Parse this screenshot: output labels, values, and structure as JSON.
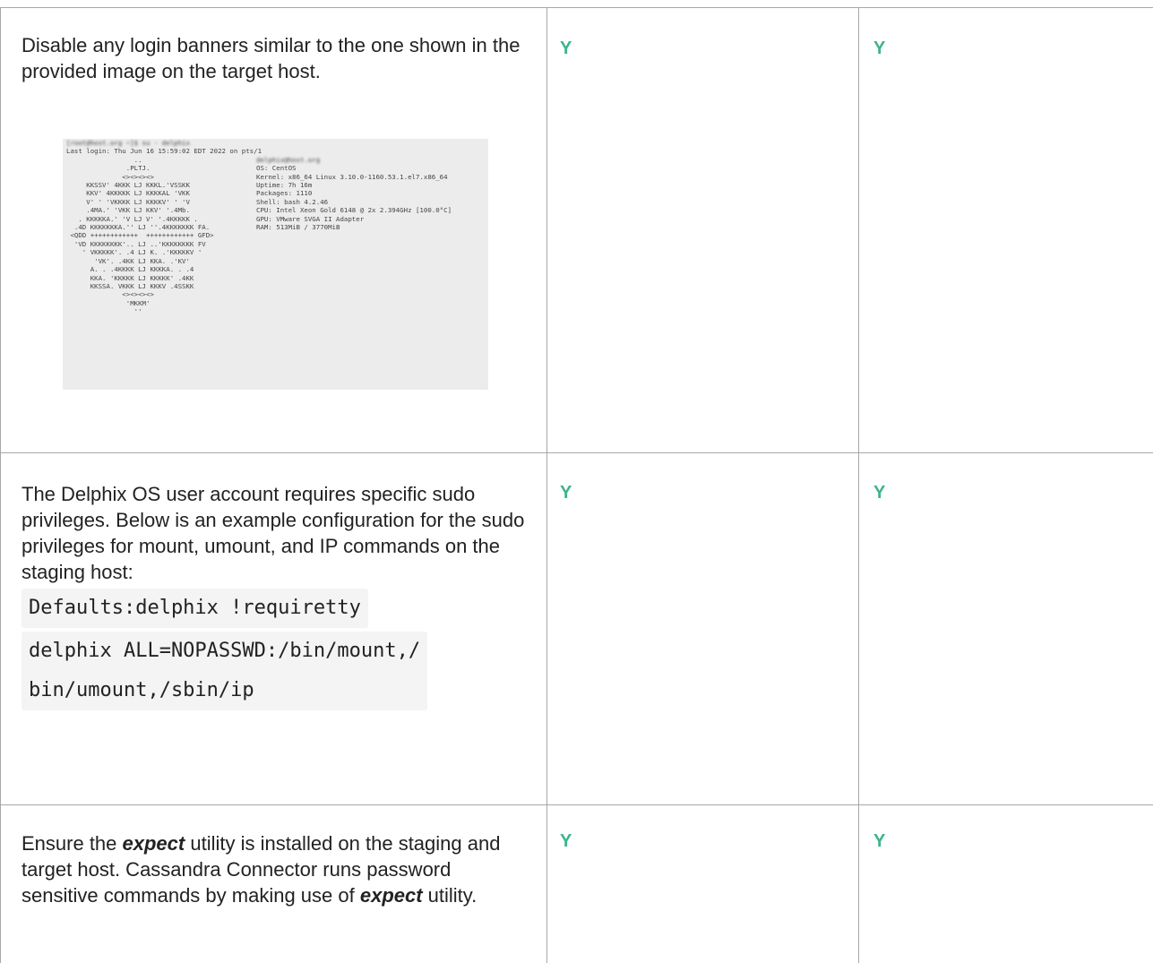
{
  "rows": [
    {
      "requirement": "Disable any login banners similar to the one shown in the provided image on the target host.",
      "col2": "Y",
      "col3": "Y",
      "banner": {
        "blurred_header": "[root@host.org ~]$ su - delphix",
        "last_login": "Last login: Thu Jun 16 15:59:02 EDT 2022 on pts/1",
        "blurred_user": "delphix@host.org",
        "art_lines": [
          "                 ..",
          "               .PLTJ.",
          "              <><><><>",
          "     KKSSV' 4KKK LJ KKKL.'VSSKK",
          "     KKV' 4KKKKK LJ KKKKAL 'VKK",
          "     V' ' 'VKKKK LJ KKKKV' ' 'V",
          "     .4MA.' 'VKK LJ KKV' '.4Mb.",
          "   . KKKKKA.' 'V LJ V' '.4KKKKK .",
          "  .4D KKKKKKKA.'' LJ ''.4KKKKKKK FA.",
          " <QDD ++++++++++++  ++++++++++++ GFD>",
          "  'VD KKKKKKKK'.. LJ ..'KKKKKKKK FV",
          "    ' VKKKKK'. .4 LJ K. .'KKKKKV '",
          "       'VK'. .4KK LJ KKA. .'KV'",
          "      A. . .4KKKK LJ KKKKA. . .4",
          "      KKA. 'KKKKK LJ KKKKK' .4KK",
          "      KKSSA. VKKK LJ KKKV .4SSKK",
          "              <><><><>",
          "               'MKKM'",
          "                 ''"
        ],
        "info_lines": [
          "OS: CentOS",
          "Kernel: x86_64 Linux 3.10.0-1160.53.1.el7.x86_64",
          "Uptime: 7h 16m",
          "Packages: 1110",
          "Shell: bash 4.2.46",
          "CPU: Intel Xeon Gold 6148 @ 2x 2.394GHz [100.0°C]",
          "GPU: VMware SVGA II Adapter",
          "RAM: 513MiB / 3770MiB"
        ]
      }
    },
    {
      "requirement": "The Delphix OS user account requires specific sudo privileges. Below is an example configuration for the sudo privileges for mount, umount, and IP commands on the staging host:",
      "col2": "Y",
      "col3": "Y",
      "code_line_1": "Defaults:delphix !requiretty",
      "code_line_2a": "delphix ALL=NOPASSWD:/bin/mount,/",
      "code_line_2b": "bin/umount,/sbin/ip"
    },
    {
      "req_part1": "Ensure the ",
      "req_em1": "expect",
      "req_part2": " utility is installed on the staging and target host. Cassandra Connector runs password sensitive commands by making use of ",
      "req_em2": "expect",
      "req_part3": " utility.",
      "col2": "Y",
      "col3": "Y"
    }
  ],
  "colors": {
    "check_green": "#3bb58a",
    "grid_line": "#a8a8a8",
    "code_bg": "#f4f4f4",
    "banner_bg": "#ececec"
  }
}
